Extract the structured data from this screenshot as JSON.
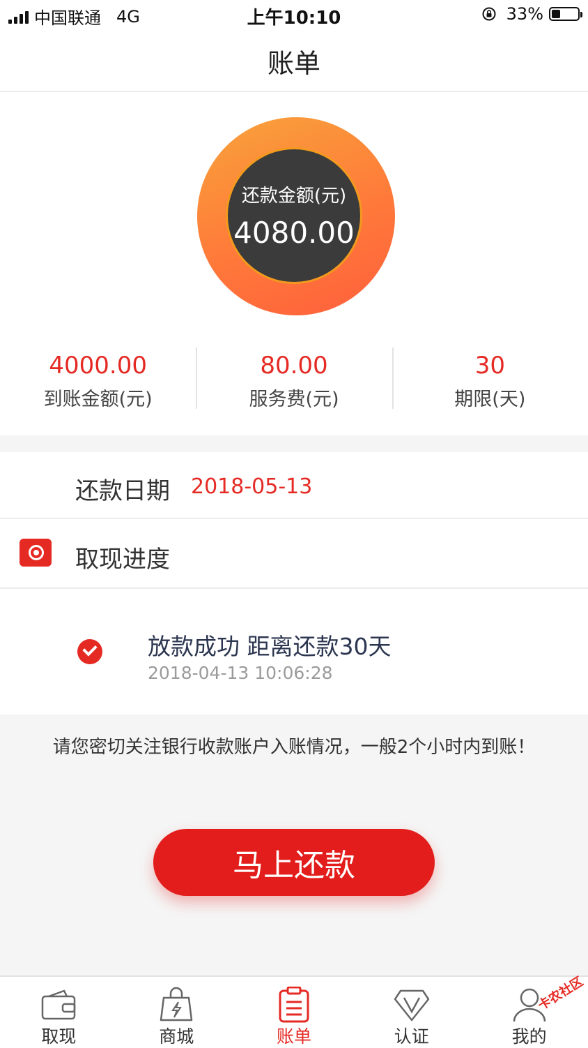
{
  "status_bar": {
    "carrier": "中国联通",
    "network": "4G",
    "time": "上午10:10",
    "battery_percent": "33%",
    "battery_level": 0.33
  },
  "nav": {
    "title": "账单"
  },
  "summary": {
    "repay_label": "还款金额(元)",
    "repay_amount": "4080.00",
    "stats": [
      {
        "value": "4000.00",
        "label": "到账金额(元)"
      },
      {
        "value": "80.00",
        "label": "服务费(元)"
      },
      {
        "value": "30",
        "label": "期限(天)"
      }
    ]
  },
  "repay_date": {
    "label": "还款日期",
    "value": "2018-05-13"
  },
  "progress": {
    "label": "取现进度",
    "timeline": [
      {
        "title": "放款成功 距离还款30天",
        "time": "2018-04-13 10:06:28"
      }
    ]
  },
  "notice": "请您密切关注银行收款账户入账情况，一般2个小时内到账！",
  "repay_button": "马上还款",
  "tabs": [
    {
      "label": "取现",
      "icon": "wallet-icon"
    },
    {
      "label": "商城",
      "icon": "shopping-bag-icon"
    },
    {
      "label": "账单",
      "icon": "bill-icon",
      "active": true
    },
    {
      "label": "认证",
      "icon": "verify-v-icon"
    },
    {
      "label": "我的",
      "icon": "user-icon"
    }
  ],
  "watermark": "卡农社区",
  "colors": {
    "accent": "#e52a24",
    "ring_start": "#f8a33b",
    "ring_end": "#ff5f3c",
    "ring_inner": "#3b3b3b"
  }
}
